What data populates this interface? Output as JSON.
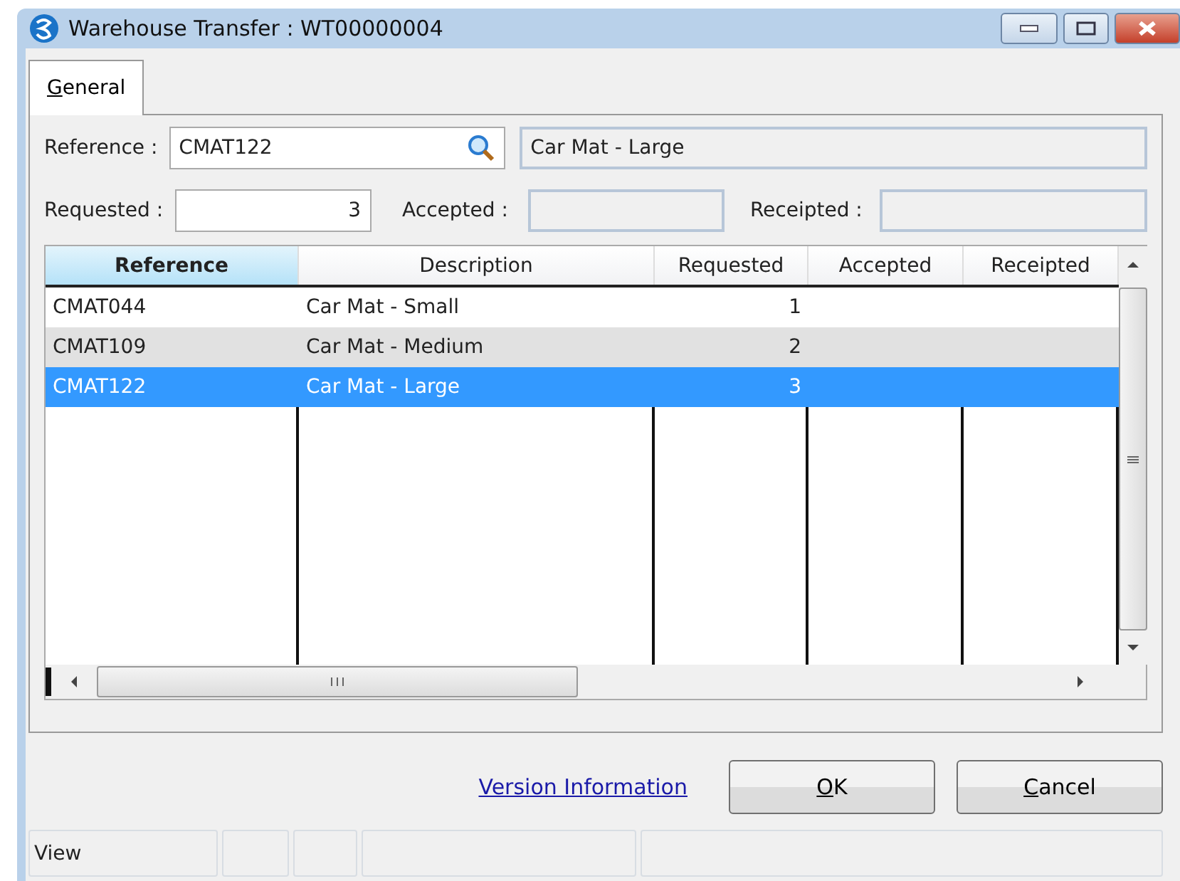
{
  "window": {
    "title": "Warehouse Transfer : WT00000004"
  },
  "tabs": [
    {
      "label": "General",
      "selected": true
    }
  ],
  "form": {
    "reference_label": "Reference :",
    "reference_value": "CMAT122",
    "reference_description": "Car Mat - Large",
    "requested_label": "Requested :",
    "requested_value": "3",
    "accepted_label": "Accepted :",
    "receipted_label": "Receipted :"
  },
  "table": {
    "columns": [
      {
        "label": "Reference",
        "sorted": true
      },
      {
        "label": "Description",
        "sorted": false
      },
      {
        "label": "Requested",
        "sorted": false
      },
      {
        "label": "Accepted",
        "sorted": false
      },
      {
        "label": "Receipted",
        "sorted": false
      }
    ],
    "rows": [
      {
        "cells": [
          "CMAT044",
          "Car Mat - Small",
          "1",
          "",
          ""
        ],
        "selected": false
      },
      {
        "cells": [
          "CMAT109",
          "Car Mat - Medium",
          "2",
          "",
          ""
        ],
        "selected": false
      },
      {
        "cells": [
          "CMAT122",
          "Car Mat - Large",
          "3",
          "",
          ""
        ],
        "selected": true
      }
    ]
  },
  "footer": {
    "link": "Version Information",
    "buttons": [
      "OK",
      "Cancel"
    ]
  },
  "status_bar": {
    "text": "View"
  }
}
